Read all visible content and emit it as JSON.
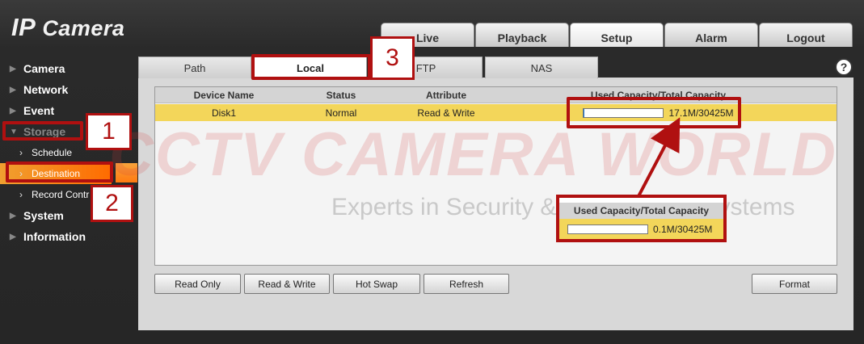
{
  "app": {
    "logo_prefix": "IP",
    "logo_suffix": "Camera"
  },
  "topnav": {
    "tabs": [
      {
        "label": "Live"
      },
      {
        "label": "Playback"
      },
      {
        "label": "Setup"
      },
      {
        "label": "Alarm"
      },
      {
        "label": "Logout"
      }
    ],
    "active": "Setup"
  },
  "sidebar": {
    "camera": "Camera",
    "network": "Network",
    "event": "Event",
    "storage": "Storage",
    "schedule": "Schedule",
    "destination": "Destination",
    "record_control": "Record Contr",
    "system": "System",
    "information": "Information"
  },
  "subtabs": {
    "path": "Path",
    "local": "Local",
    "ftp": "FTP",
    "nas": "NAS"
  },
  "help_icon": "?",
  "table": {
    "headers": {
      "device_name": "Device Name",
      "status": "Status",
      "attribute": "Attribute",
      "capacity": "Used Capacity/Total Capacity"
    },
    "rows": [
      {
        "device_name": "Disk1",
        "status": "Normal",
        "attribute": "Read & Write",
        "capacity": "17.1M/30425M",
        "used_fraction": 0.0006
      }
    ]
  },
  "buttons": {
    "read_only": "Read Only",
    "read_write": "Read & Write",
    "hot_swap": "Hot Swap",
    "refresh": "Refresh",
    "format": "Format"
  },
  "watermark": {
    "main": "CCTV CAMERA WORLD",
    "tagline": "Experts in Security & Surveillance Systems"
  },
  "annotations": {
    "step1": "1",
    "step2": "2",
    "step3": "3",
    "zoom_header": "Used Capacity/Total Capacity",
    "zoom_value": "0.1M/30425M",
    "zoom_fraction": 0.0
  },
  "colors": {
    "highlight_row": "#f3d65a",
    "active_menu": "#ff6b00",
    "annotation": "#b01010"
  }
}
